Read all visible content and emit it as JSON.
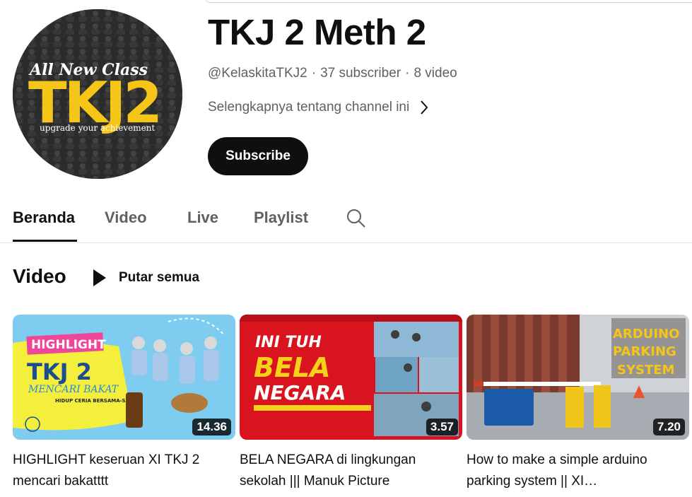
{
  "channel": {
    "name": "TKJ 2 Meth 2",
    "handle": "@KelaskitaTKJ2",
    "subscribers": "37 subscriber",
    "videos_count": "8 video",
    "more_about": "Selengkapnya tentang channel ini",
    "subscribe_label": "Subscribe",
    "avatar": {
      "line1": "All New Class",
      "main_text": "TKJ2",
      "tagline": "upgrade your achievement",
      "text_color": "#f5c518"
    }
  },
  "tabs": [
    {
      "label": "Beranda",
      "active": true
    },
    {
      "label": "Video",
      "active": false
    },
    {
      "label": "Live",
      "active": false
    },
    {
      "label": "Playlist",
      "active": false
    }
  ],
  "section": {
    "title": "Video",
    "play_all_label": "Putar semua"
  },
  "videos": [
    {
      "title": "HIGHLIGHT keseruan XI TKJ 2 mencari bakatttt",
      "duration": "14.36",
      "thumb_text": {
        "badge": "HIGHLIGHT",
        "main": "TKJ 2",
        "script": "MENCARI BAKAT",
        "sub": "HIDUP CERIA BERSAMA-SAMA"
      }
    },
    {
      "title": "BELA NEGARA di lingkungan sekolah ||| Manuk Picture",
      "duration": "3.57",
      "thumb_text": {
        "line1": "INI TUH",
        "line2": "BELA",
        "line3": "NEGARA"
      }
    },
    {
      "title": "How to make a simple arduino parking system || XI…",
      "duration": "7.20",
      "thumb_text": {
        "line1": "ARDUINO",
        "line2": "PARKING",
        "line3": "SYSTEM"
      }
    }
  ],
  "colors": {
    "accent": "#0f0f0f",
    "secondary_text": "#606060",
    "thumb1_bg": "#7ecdf0",
    "thumb2_bg": "#d9141e",
    "thumb3_text": "#f5c518"
  }
}
